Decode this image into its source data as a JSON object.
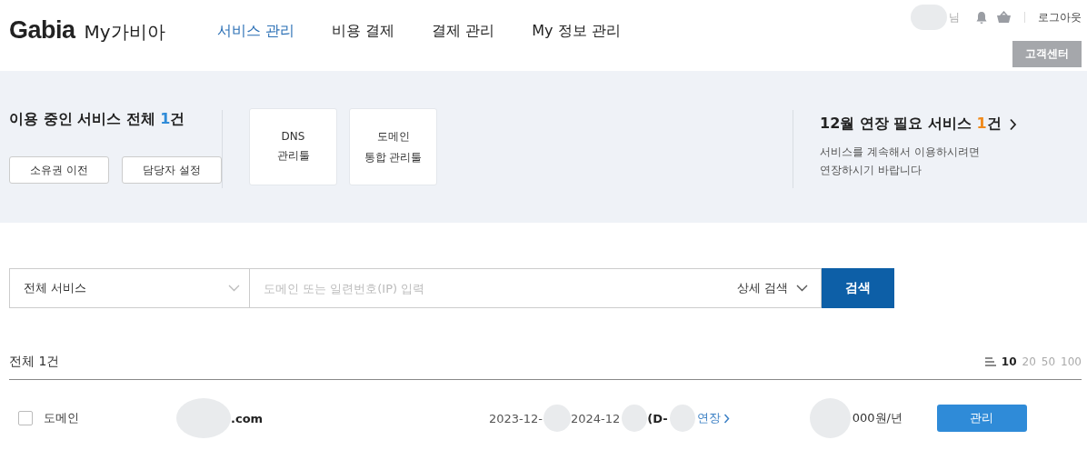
{
  "header": {
    "logo": "Gabia",
    "logo_sub": "My가비아",
    "nav": [
      {
        "label": "서비스 관리",
        "selected": true
      },
      {
        "label": "비용 결제",
        "selected": false
      },
      {
        "label": "결제 관리",
        "selected": false
      },
      {
        "label": "My 정보 관리",
        "selected": false
      }
    ],
    "user_suffix": "님",
    "logout": "로그아웃",
    "support": "고객센터"
  },
  "summary": {
    "title": "이용 중인 서비스 전체 ",
    "count": "1",
    "count_unit": "건",
    "buttons": [
      "소유권 이전",
      "담당자 설정"
    ],
    "tools": [
      {
        "lines": [
          "DNS",
          "관리툴"
        ]
      },
      {
        "lines": [
          "도메인",
          "통합 관리툴"
        ]
      }
    ],
    "renewal": {
      "title": "12월 연장 필요 서비스 ",
      "count": "1",
      "count_unit": "건",
      "desc": [
        "서비스를 계속해서 이용하시려면",
        "연장하시기 바랍니다"
      ]
    }
  },
  "search": {
    "category": "전체 서비스",
    "placeholder": "도메인 또는 일련번호(IP) 입력",
    "detail": "상세 검색",
    "button": "검색"
  },
  "list": {
    "total": "전체 1건",
    "page_sizes": [
      {
        "label": "10",
        "selected": true
      },
      {
        "label": "20",
        "selected": false
      },
      {
        "label": "50",
        "selected": false
      },
      {
        "label": "100",
        "selected": false
      }
    ],
    "rows": [
      {
        "checked": false,
        "type": "도메인",
        "domain": ".com",
        "start": "2023-12-",
        "end": "2024-12",
        "dday": "(D-",
        "renew": "연장",
        "price": "000원/년",
        "action": "관리"
      }
    ]
  }
}
